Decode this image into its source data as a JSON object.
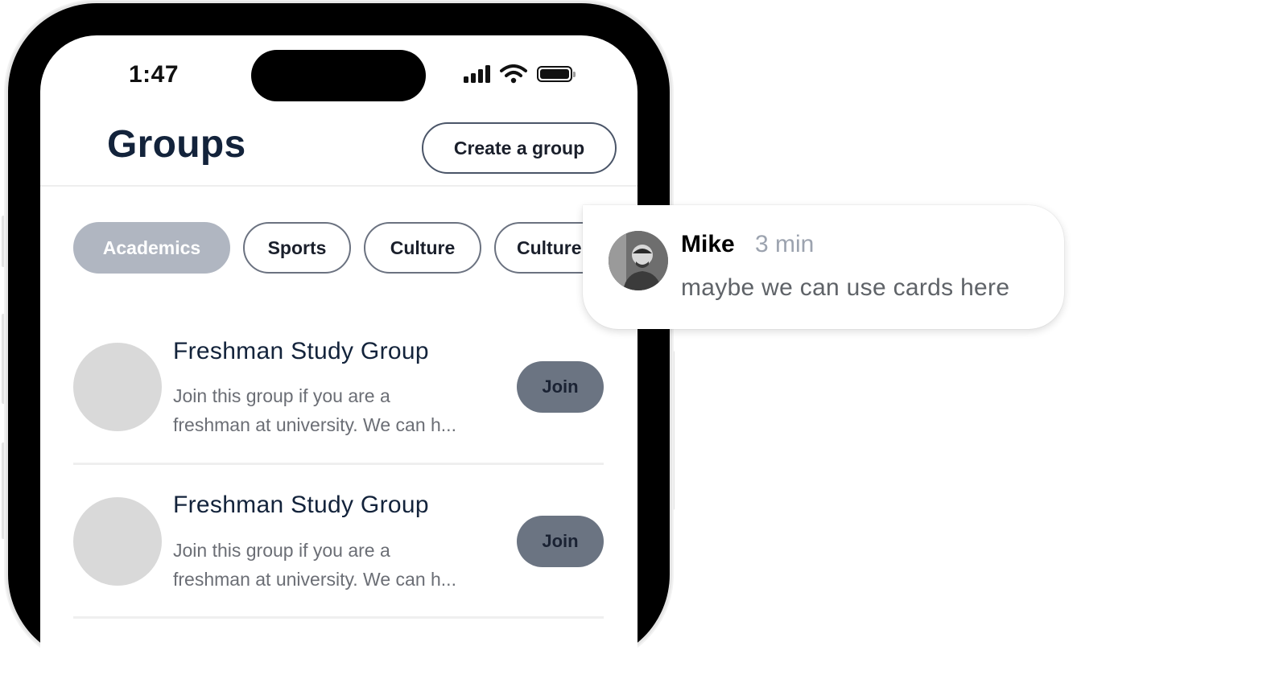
{
  "status_bar": {
    "time": "1:47"
  },
  "header": {
    "title": "Groups",
    "create_button": "Create a group"
  },
  "filters": [
    {
      "label": "Academics",
      "active": true
    },
    {
      "label": "Sports",
      "active": false
    },
    {
      "label": "Culture",
      "active": false
    },
    {
      "label": "Culture",
      "active": false
    }
  ],
  "groups": [
    {
      "name": "Freshman Study Group",
      "description_line1": "Join this group if you are a",
      "description_line2": "freshman at university. We can h...",
      "action": "Join"
    },
    {
      "name": "Freshman Study Group",
      "description_line1": "Join this group if you are a",
      "description_line2": "freshman at university. We can h...",
      "action": "Join"
    }
  ],
  "comment": {
    "author": "Mike",
    "time": "3 min",
    "text": "maybe we can use cards here"
  },
  "colors": {
    "title": "#13233b",
    "chip_active_bg": "#b0b6c1",
    "join_bg": "#6b7482",
    "avatar_placeholder": "#d9d9d9"
  },
  "icons": [
    "signal-icon",
    "wifi-icon",
    "battery-icon"
  ]
}
